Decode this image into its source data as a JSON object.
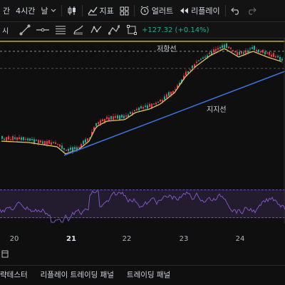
{
  "toolbar": {
    "symbol_cut": "시",
    "timeframe_cut": "간",
    "timeframe_4h": "4시간",
    "timeframe_day": "날",
    "indicators_label": "지표",
    "alert_label": "얼러트",
    "replay_label": "리플레이",
    "undo_icon": "undo-icon",
    "redo_icon": "redo-icon"
  },
  "drawbar": {
    "symbol_cut": "시",
    "change_text": "+127.32 (+0.14%)"
  },
  "chart": {
    "resistance_label": "저항선",
    "support_label": "지지선",
    "colors": {
      "resistance": "#e0d23a",
      "support": "#3d6fd6",
      "ma": "#e6c36a",
      "up": "#22ab94",
      "down": "#f23645",
      "rsi": "#7e57c2"
    }
  },
  "timeaxis": {
    "ticks": [
      "20",
      "21",
      "22",
      "23",
      "24"
    ]
  },
  "bottom_tabs": {
    "tab_backtest": "략테스터",
    "tab_replay_panel": "리플레이 트레이딩 패널",
    "tab_trading_panel": "트레이딩 패널"
  }
}
